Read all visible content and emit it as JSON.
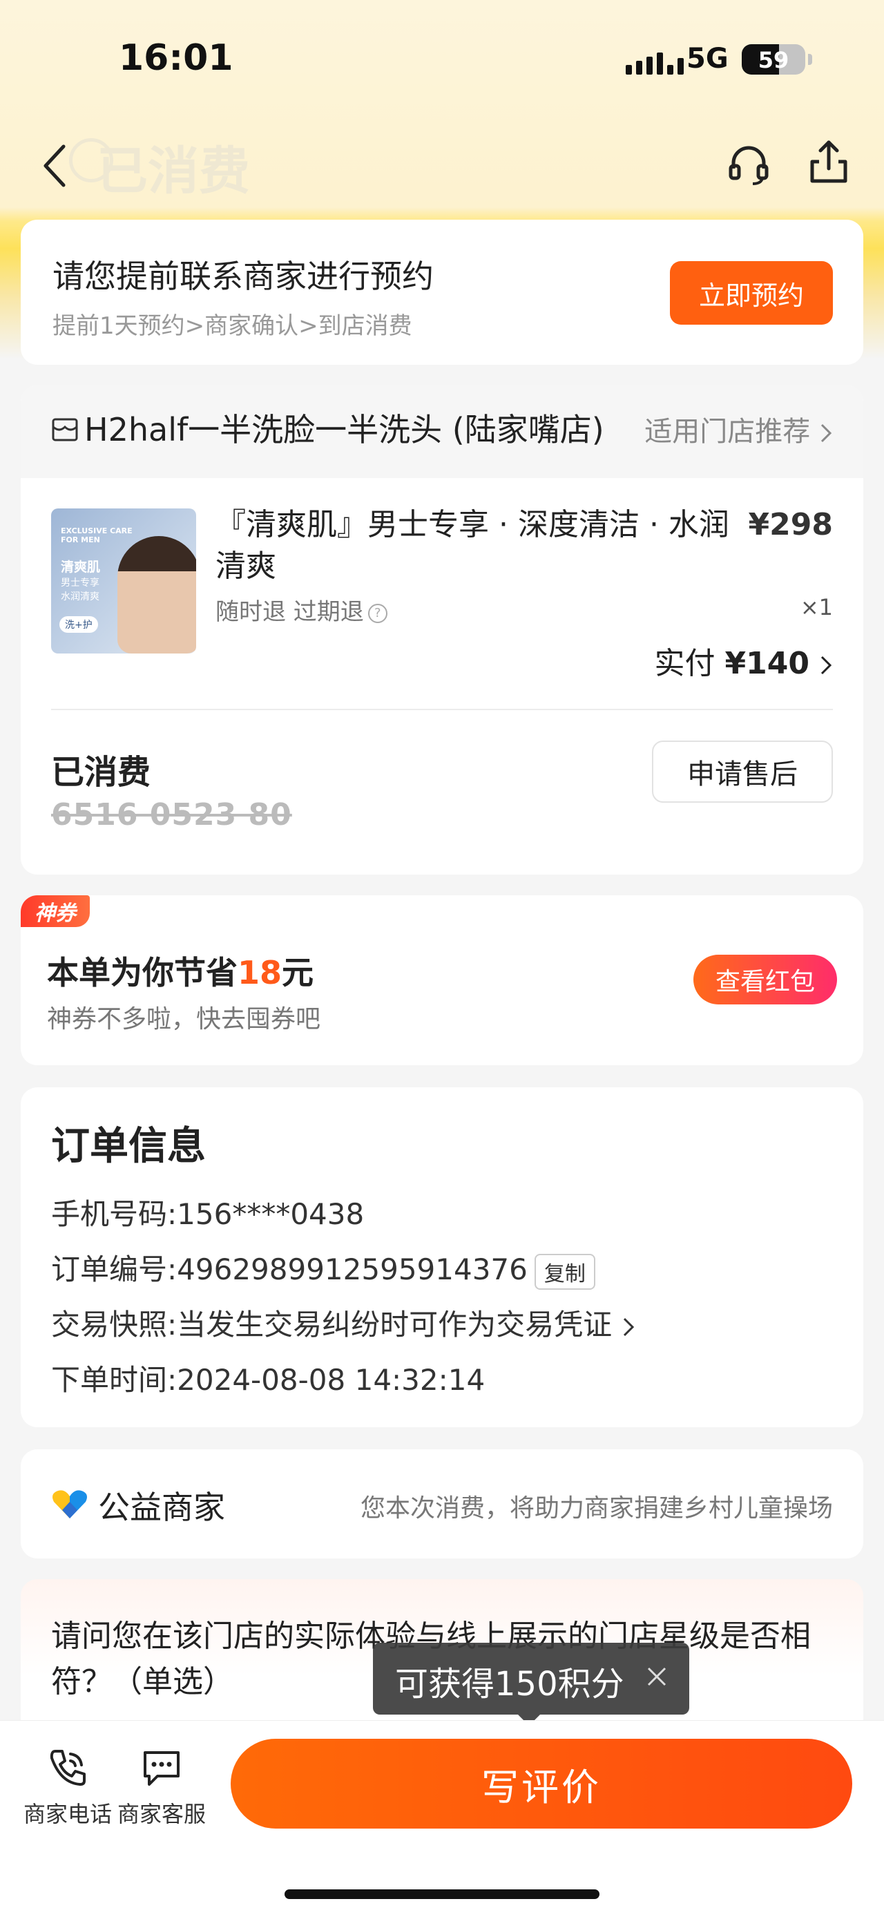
{
  "status_bar": {
    "time": "16:01",
    "network": "5G",
    "battery": "59",
    "battery_level": 0.59
  },
  "nav": {
    "title": "已消费",
    "back_icon": "chevron-left-icon",
    "service_icon": "headset-icon",
    "share_icon": "share-icon"
  },
  "booking": {
    "title": "请您提前联系商家进行预约",
    "steps": "提前1天预约>商家确认>到店消费",
    "button": "立即预约"
  },
  "product": {
    "store_name": "H2half一半洗脸一半洗头 (陆家嘴店)",
    "store_link": "适用门店推荐",
    "thumb": {
      "headline": "EXCLUSIVE CARE FOR MEN",
      "name": "清爽肌",
      "line1": "男士专享",
      "line2": "水润清爽",
      "pill": "洗+护"
    },
    "title": "『清爽肌』男士专享 · 深度清洁 · 水润清爽",
    "price": "¥298",
    "refund": "随时退 过期退",
    "qty": "×1",
    "paid_label": "实付",
    "paid_amount": "¥140",
    "status": "已消费",
    "code": "6516 0523 80",
    "after_sale_button": "申请售后"
  },
  "coupon": {
    "tag": "神券",
    "text_before": "本单为你节省",
    "amount": "18",
    "text_after": "元",
    "subtitle": "神券不多啦，快去囤券吧",
    "button": "查看红包"
  },
  "order_info": {
    "title": "订单信息",
    "phone_label": "手机号码:",
    "phone": "156****0438",
    "order_no_label": "订单编号:",
    "order_no": "4962989912595914376",
    "copy": "复制",
    "snapshot_label": "交易快照:",
    "snapshot": "当发生交易纠纷时可作为交易凭证",
    "time_label": "下单时间:",
    "time": "2024-08-08 14:32:14"
  },
  "charity": {
    "title": "公益商家",
    "note": "您本次消费，将助力商家捐建乡村儿童操场"
  },
  "survey": {
    "question": "请问您在该门店的实际体验与线上展示的门店星级是否相符？（单选）"
  },
  "tooltip": {
    "text": "可获得150积分"
  },
  "bottom": {
    "phone_label": "商家电话",
    "chat_label": "商家客服",
    "review_button": "写评价"
  },
  "colors": {
    "accent": "#ff6010",
    "coupon_red": "#ff2d6a",
    "header_yellow": "#fde15a"
  }
}
